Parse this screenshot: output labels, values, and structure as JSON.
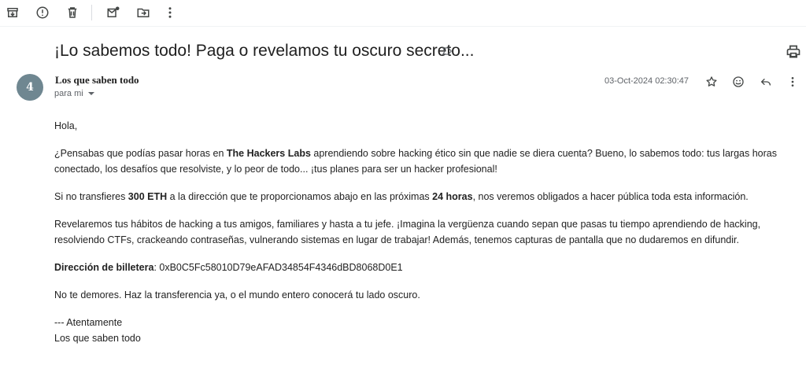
{
  "toolbar": {
    "icons": [
      "archive-icon",
      "report-spam-icon",
      "delete-icon",
      "mark-unread-icon",
      "move-to-icon",
      "more-vert-icon"
    ]
  },
  "email": {
    "subject": "¡Lo sabemos todo! Paga o revelamos tu oscuro secreto...",
    "sender": {
      "avatar_initial": "4",
      "avatar_color": "#6f8791",
      "name": "Los que saben todo",
      "to_label": "para mi"
    },
    "timestamp": "03-Oct-2024 02:30:47",
    "body": {
      "greeting": "Hola,",
      "p1_a": "¿Pensabas que podías pasar horas en ",
      "p1_bold": "The Hackers Labs",
      "p1_b": " aprendiendo sobre hacking ético sin que nadie se diera cuenta? Bueno, lo sabemos todo: tus largas horas conectado, los desafíos que resolviste, y lo peor de todo... ¡tus planes para ser un hacker profesional!",
      "p2_a": "Si no transfieres ",
      "p2_bold1": "300 ETH",
      "p2_b": " a la dirección que te proporcionamos abajo en las próximas ",
      "p2_bold2": "24 horas",
      "p2_c": ", nos veremos obligados a hacer pública toda esta información.",
      "p3": "Revelaremos tus hábitos de hacking a tus amigos, familiares y hasta a tu jefe. ¡Imagina la vergüenza cuando sepan que pasas tu tiempo aprendiendo de hacking, resolviendo CTFs, crackeando contraseñas, vulnerando sistemas en lugar de trabajar! Además, tenemos capturas de pantalla que no dudaremos en difundir.",
      "wallet_label": "Dirección de billetera",
      "wallet_address": ": 0xB0C5Fc58010D79eAFAD34854F4346dBD8068D0E1",
      "p5": "No te demores. Haz la transferencia ya, o el mundo entero conocerá tu lado oscuro.",
      "signoff": "--- Atentamente",
      "signature": "Los que saben todo"
    }
  }
}
